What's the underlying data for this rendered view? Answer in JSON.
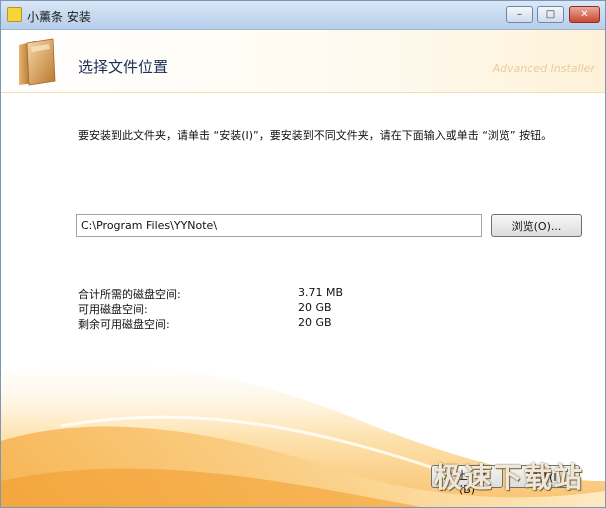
{
  "window": {
    "title": "小薰条 安装",
    "brand": "Advanced Installer",
    "controls": {
      "minimize": "–",
      "maximize": "□",
      "close": "✕"
    }
  },
  "header": {
    "title": "选择文件位置",
    "icon": "folder-icon"
  },
  "main": {
    "instructions": "要安装到此文件夹，请单击 “安装(I)”，要安装到不同文件夹，请在下面输入或单击 “浏览” 按钮。",
    "path_value": "C:\\Program Files\\YYNote\\",
    "browse_label": "浏览(O)...",
    "disk_info": [
      {
        "label": "合计所需的磁盘空间:",
        "value": "3.71 MB"
      },
      {
        "label": "可用磁盘空间:",
        "value": "20 GB"
      },
      {
        "label": "剩余可用磁盘空间:",
        "value": "20 GB"
      }
    ]
  },
  "footer": {
    "back_label": "< 上一步(B)",
    "next_label": "安装(I)",
    "watermark": "极速下载站"
  },
  "colors": {
    "accent_orange": "#f5a623",
    "title_blue": "#1b2c55",
    "titlebar": "#c4d8ef"
  }
}
